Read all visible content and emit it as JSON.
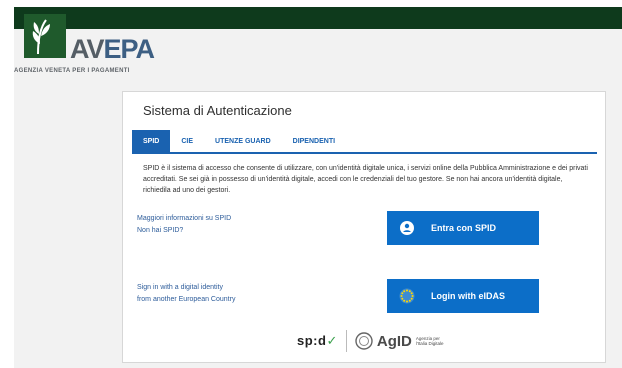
{
  "brand": {
    "name_part1": "AV",
    "name_part2": "EPA",
    "subtitle": "AGENZIA VENETA PER I PAGAMENTI"
  },
  "panel": {
    "title": "Sistema di Autenticazione",
    "tabs": [
      {
        "label": "SPID",
        "active": true
      },
      {
        "label": "CIE",
        "active": false
      },
      {
        "label": "UTENZE GUARD",
        "active": false
      },
      {
        "label": "DIPENDENTI",
        "active": false
      }
    ],
    "description": "SPID è il sistema di accesso che consente di utilizzare, con un'identità digitale unica, i servizi online della Pubblica Amministrazione e dei privati accreditati. Se sei già in possesso di un'identità digitale, accedi con le credenziali del tuo gestore. Se non hai ancora un'identità digitale, richiedila ad uno dei gestori.",
    "spid_links": {
      "more_info": "Maggiori informazioni su SPID",
      "no_spid": "Non hai SPID?"
    },
    "spid_button": "Entra con SPID",
    "eidas_text": {
      "line1": "Sign in with a digital identity",
      "line2": "from another European Country"
    },
    "eidas_button": "Login with eIDAS",
    "footer": {
      "spid_logo": "sp:d",
      "agid_logo": "AgID",
      "agid_sub_line1": "Agenzia per",
      "agid_sub_line2": "l'Italia Digitale"
    }
  },
  "colors": {
    "topbar": "#0e3a1c",
    "accent": "#1a62b0",
    "button": "#0c6ec8"
  },
  "icons": {
    "spid_button_icon": "user-circle-icon",
    "eidas_button_icon": "eu-stars-icon"
  }
}
